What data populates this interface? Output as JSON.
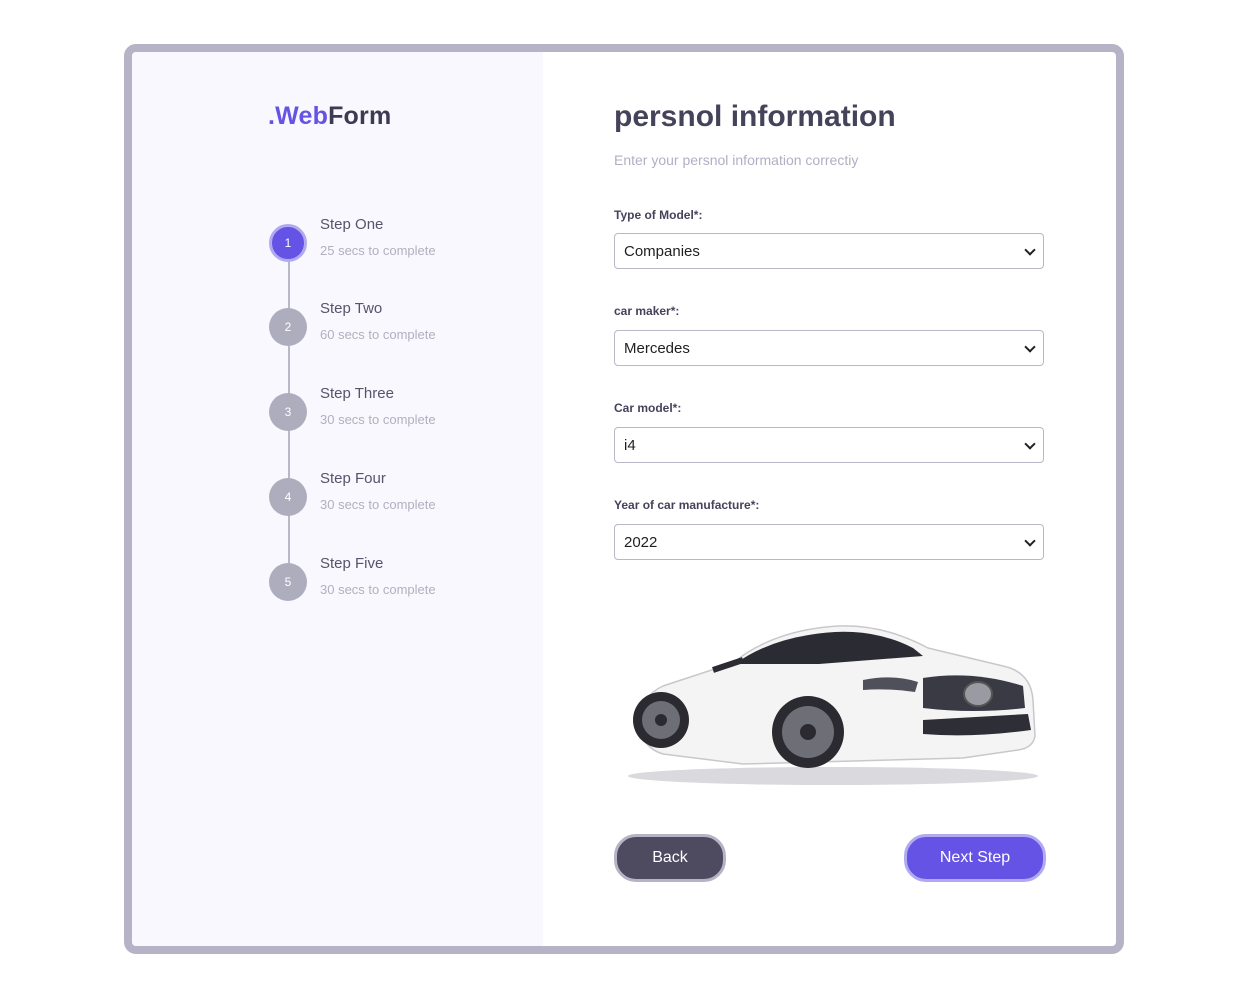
{
  "brand": {
    "prefix": ".",
    "accent": "Web",
    "rest": "Form"
  },
  "steps": [
    {
      "number": "1",
      "title": "Step One",
      "subtitle": "25 secs to complete",
      "active": true
    },
    {
      "number": "2",
      "title": "Step Two",
      "subtitle": "60 secs to complete",
      "active": false
    },
    {
      "number": "3",
      "title": "Step Three",
      "subtitle": "30 secs to complete",
      "active": false
    },
    {
      "number": "4",
      "title": "Step Four",
      "subtitle": "30 secs to complete",
      "active": false
    },
    {
      "number": "5",
      "title": "Step Five",
      "subtitle": "30 secs to complete",
      "active": false
    }
  ],
  "form": {
    "heading": "persnol information",
    "subheading": "Enter your persnol information correctiy",
    "fields": [
      {
        "label": "Type of Model*:",
        "value": "Companies"
      },
      {
        "label": "car maker*:",
        "value": "Mercedes"
      },
      {
        "label": "Car model*:",
        "value": "i4"
      },
      {
        "label": "Year of car manufacture*:",
        "value": "2022"
      }
    ]
  },
  "buttons": {
    "back": "Back",
    "next": "Next Step"
  },
  "colors": {
    "accent": "#6453e4",
    "dark": "#4e4a60",
    "border": "#b6b3c6",
    "sidebar_bg": "#f8f8fe"
  },
  "image": {
    "name": "car-photo"
  }
}
